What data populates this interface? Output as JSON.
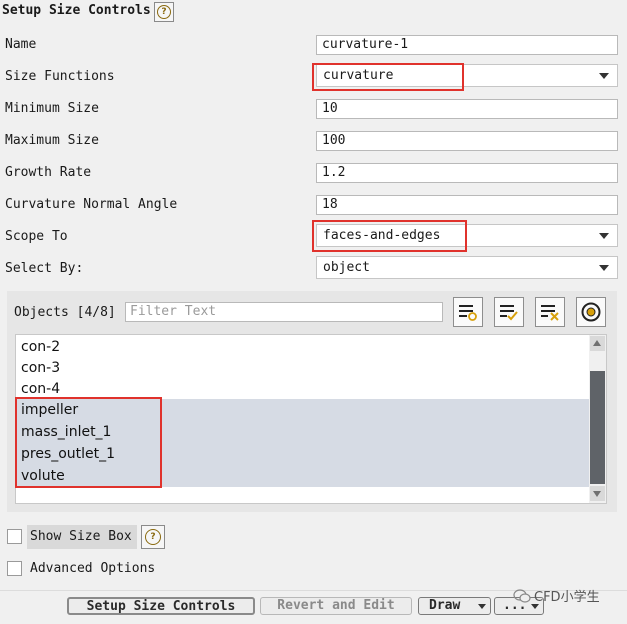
{
  "title": "Setup Size Controls",
  "rows": {
    "name": {
      "label": "Name",
      "value": "curvature-1"
    },
    "size_functions": {
      "label": "Size Functions",
      "value": "curvature"
    },
    "min_size": {
      "label": "Minimum Size",
      "value": "10"
    },
    "max_size": {
      "label": "Maximum Size",
      "value": "100"
    },
    "growth_rate": {
      "label": "Growth Rate",
      "value": "1.2"
    },
    "curv_angle": {
      "label": "Curvature Normal Angle",
      "value": "18"
    },
    "scope_to": {
      "label": "Scope To",
      "value": "faces-and-edges"
    },
    "select_by": {
      "label": "Select By:",
      "value": "object"
    }
  },
  "objects": {
    "label": "Objects [4/8]",
    "filter_placeholder": "Filter Text",
    "items": [
      {
        "label": "con-2",
        "selected": false
      },
      {
        "label": "con-3",
        "selected": false
      },
      {
        "label": "con-4",
        "selected": false
      },
      {
        "label": "impeller",
        "selected": true
      },
      {
        "label": "mass_inlet_1",
        "selected": true
      },
      {
        "label": "pres_outlet_1",
        "selected": true
      },
      {
        "label": "volute",
        "selected": true
      }
    ]
  },
  "options": {
    "show_size_box": "Show Size Box",
    "advanced": "Advanced Options"
  },
  "buttons": {
    "setup": "Setup Size Controls",
    "revert": "Revert and Edit",
    "draw": "Draw",
    "more": "..."
  },
  "watermark": "CFD小学生",
  "colors": {
    "highlight": "#e0322c",
    "selection": "#d6dbe4"
  }
}
